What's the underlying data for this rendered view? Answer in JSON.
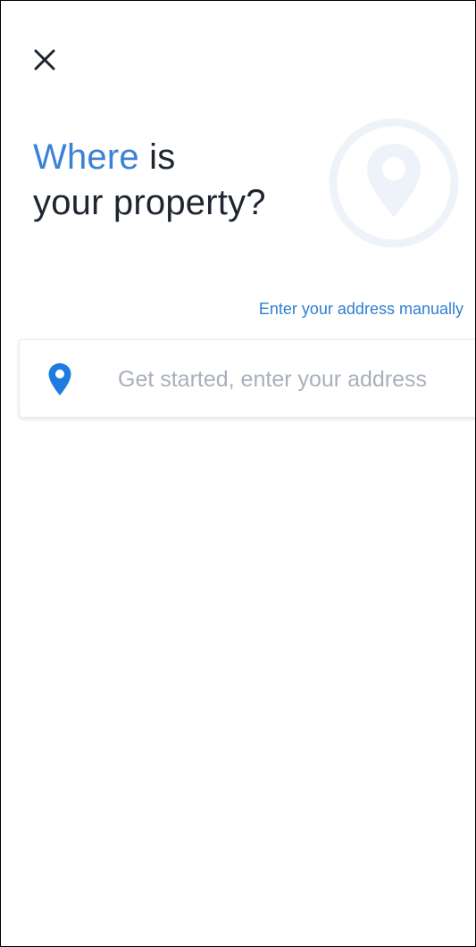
{
  "header": {
    "close_icon": "close-icon",
    "title_highlight": "Where",
    "title_rest_line1": " is",
    "title_line2": "your property?",
    "hero_icon": "map-pin-icon"
  },
  "links": {
    "manual_entry": "Enter your address manually"
  },
  "search": {
    "icon": "map-pin-icon",
    "placeholder": "Get started, enter your address",
    "value": ""
  },
  "colors": {
    "accent": "#3b82d6",
    "link": "#2f7fd0",
    "title_text": "#1f2530",
    "placeholder": "#a8b0bb",
    "pin_blue": "#1e7be0",
    "hero_pin_tint": "#eef3fa"
  }
}
